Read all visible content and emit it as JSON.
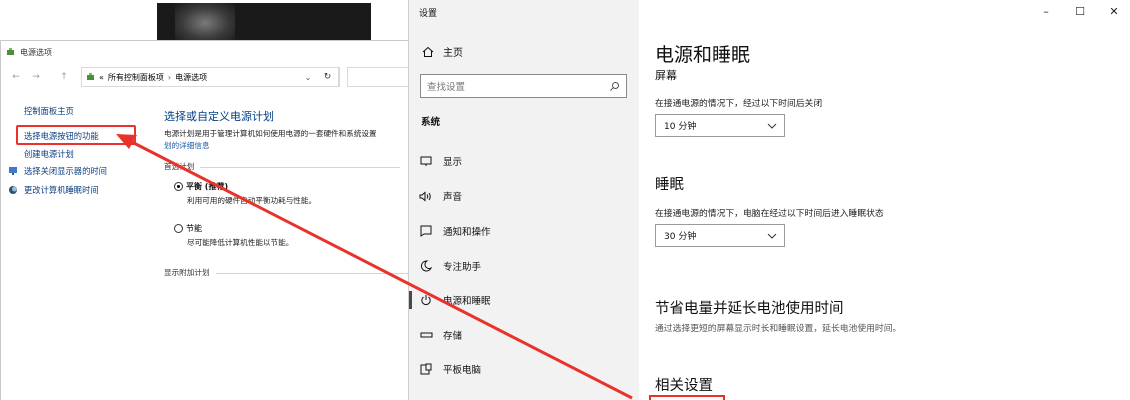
{
  "control_panel": {
    "title": "电源选项",
    "nav": {
      "back": "←",
      "forward": "→",
      "up": "↑"
    },
    "address": {
      "prefix": "«",
      "crumb1": "所有控制面板项",
      "separator": "›",
      "crumb2": "电源选项",
      "dropdown": "⌄",
      "refresh": "↻"
    },
    "sidebar": {
      "home": "控制面板主页",
      "power_buttons": "选择电源按钮的功能",
      "create_plan": "创建电源计划",
      "display_off": "选择关闭显示器的时间",
      "sleep_time": "更改计算机睡眠时间"
    },
    "main": {
      "title": "选择或自定义电源计划",
      "description": "电源计划是用于管理计算机如何使用电源的一套硬件和系统设置",
      "learn_more": "划的详细信息",
      "plans_label": "首选计划",
      "plans": [
        {
          "name": "平衡 (推荐)",
          "description": "利用可用的硬件自动平衡功耗与性能。",
          "selected": true
        },
        {
          "name": "节能",
          "description": "尽可能降低计算机性能以节能。",
          "selected": false
        }
      ],
      "extra_plans_label": "显示附加计划"
    }
  },
  "settings": {
    "window_title": "设置",
    "home": "主页",
    "search_placeholder": "查找设置",
    "section_label": "系统",
    "nav_items": [
      {
        "label": "显示",
        "icon": "monitor-icon"
      },
      {
        "label": "声音",
        "icon": "speaker-icon"
      },
      {
        "label": "通知和操作",
        "icon": "notification-icon"
      },
      {
        "label": "专注助手",
        "icon": "moon-icon"
      },
      {
        "label": "电源和睡眠",
        "icon": "power-icon",
        "selected": true
      },
      {
        "label": "存储",
        "icon": "storage-icon"
      },
      {
        "label": "平板电脑",
        "icon": "tablet-icon"
      }
    ],
    "window_controls": {
      "minimize": "–",
      "maximize": "☐",
      "close": "✕"
    },
    "page_title": "电源和睡眠",
    "screen": {
      "heading": "屏幕",
      "label": "在接通电源的情况下，经过以下时间后关闭",
      "value": "10 分钟"
    },
    "sleep": {
      "heading": "睡眠",
      "label": "在接通电源的情况下，电脑在经过以下时间后进入睡眠状态",
      "value": "30 分钟"
    },
    "battery": {
      "heading": "节省电量并延长电池使用时间",
      "description": "通过选择更短的屏幕显示时长和睡眠设置，延长电池使用时间。"
    },
    "related": {
      "heading": "相关设置"
    }
  },
  "annotation": {
    "color": "#e8322b"
  }
}
